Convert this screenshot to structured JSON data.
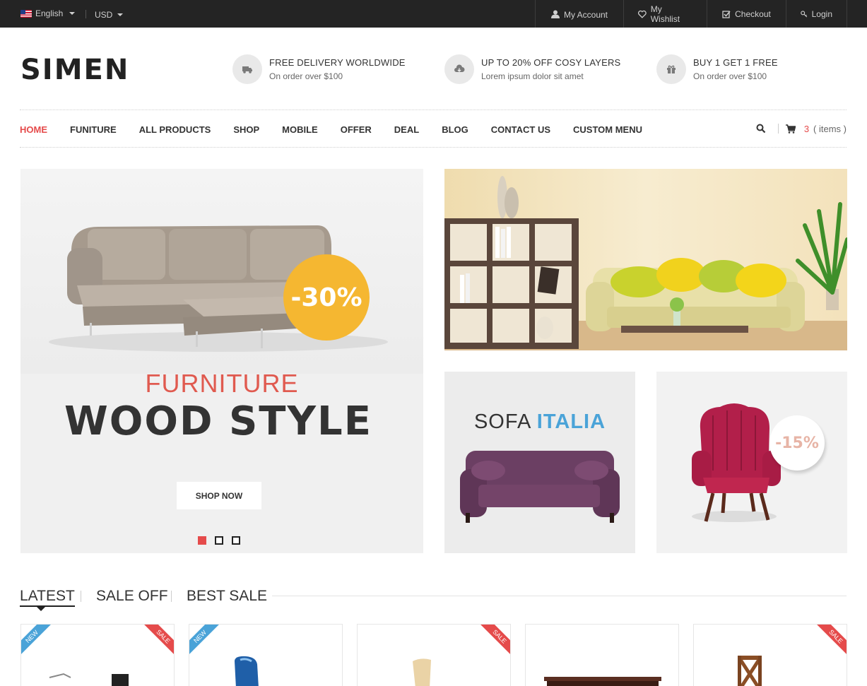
{
  "topbar": {
    "language": "English",
    "currency": "USD",
    "links": [
      "My Account",
      "My Wishlist",
      "Checkout",
      "Login"
    ]
  },
  "header": {
    "logo": "SIMEN",
    "promos": [
      {
        "title": "FREE DELIVERY WORLDWIDE",
        "subtitle": "On order over $100",
        "icon": "truck-icon"
      },
      {
        "title": "UP TO 20% OFF COSY LAYERS",
        "subtitle": "Lorem ipsum dolor sit amet",
        "icon": "cloud-download-icon"
      },
      {
        "title": "BUY 1 GET 1 FREE",
        "subtitle": "On order over $100",
        "icon": "gift-icon"
      }
    ]
  },
  "nav": {
    "items": [
      "HOME",
      "FUNITURE",
      "ALL PRODUCTS",
      "SHOP",
      "MOBILE",
      "OFFER",
      "DEAL",
      "BLOG",
      "CONTACT US",
      "CUSTOM MENU"
    ],
    "active": "HOME",
    "cart_count": "3",
    "cart_label": "( items )"
  },
  "hero": {
    "discount": "-30%",
    "subtitle": "FURNITURE",
    "title": "WOOD STYLE",
    "button": "SHOP NOW",
    "slides": 3,
    "active_slide": 1
  },
  "banners": {
    "sofa_title_a": "SOFA",
    "sofa_title_b": "ITALIA",
    "chair_discount": "-15%"
  },
  "product_tabs": [
    "LATEST",
    "SALE OFF",
    "BEST SALE"
  ],
  "products": [
    {
      "badge_left": "NEW",
      "badge_right": "SALE"
    },
    {
      "badge_left": "NEW",
      "badge_right": ""
    },
    {
      "badge_left": "",
      "badge_right": "SALE"
    },
    {
      "badge_left": "",
      "badge_right": ""
    },
    {
      "badge_left": "",
      "badge_right": "SALE"
    }
  ],
  "colors": {
    "accent": "#e54b4b",
    "blue": "#4aa3d8",
    "yellow": "#f5b731",
    "topbar": "#242424"
  }
}
